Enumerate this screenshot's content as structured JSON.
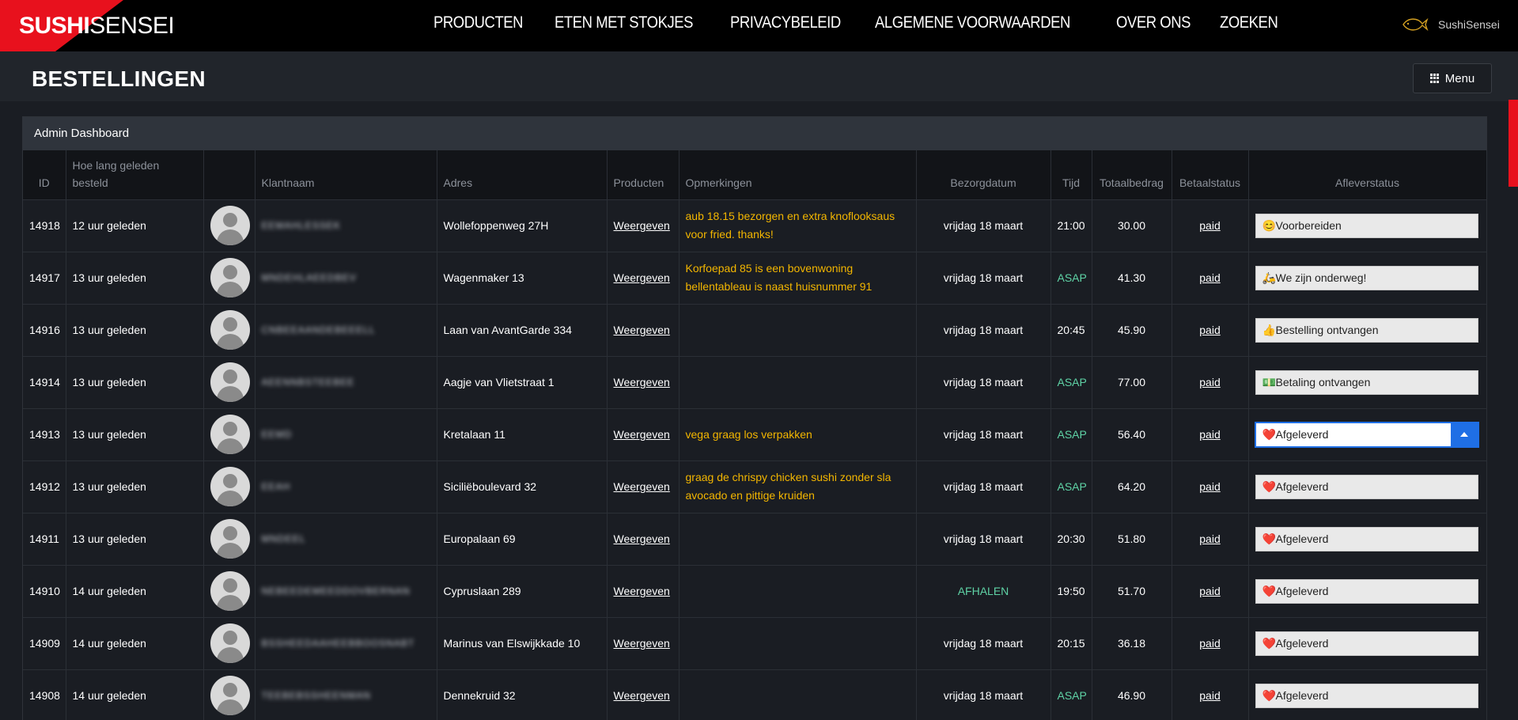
{
  "nav": {
    "logo_bold": "SUSHI",
    "logo_light": "SENSEI",
    "links": [
      "PRODUCTEN",
      "ETEN MET STOKJES",
      "PRIVACYBELEID",
      "ALGEMENE VOORWAARDEN",
      "OVER ONS",
      "ZOEKEN"
    ],
    "brand_name": "SushiSensei"
  },
  "page": {
    "title": "BESTELLINGEN",
    "menu_label": "Menu"
  },
  "panel": {
    "title": "Admin Dashboard"
  },
  "table": {
    "headers": [
      "ID",
      "Hoe lang geleden besteld",
      "",
      "Klantnaam",
      "Adres",
      "Producten",
      "Opmerkingen",
      "Bezorgdatum",
      "Tijd",
      "Totaalbedrag",
      "Betaalstatus",
      "Afleverstatus"
    ],
    "rows": [
      {
        "id": "14918",
        "ago": "12 uur geleden",
        "name": "EEMAHLESSEK",
        "address": "Wollefoppenweg 27H",
        "products": "Weergeven",
        "note": "aub 18.15 bezorgen en extra knoflooksaus voor fried. thanks!",
        "date": "vrijdag 18 maart",
        "time": "21:00",
        "total": "30.00",
        "pay": "paid",
        "status_emoji": "😊",
        "status": "Voorbereiden"
      },
      {
        "id": "14917",
        "ago": "13 uur geleden",
        "name": "MNDEHLAEEDBEV",
        "address": "Wagenmaker 13",
        "products": "Weergeven",
        "note": "Korfoepad 85 is een bovenwoning bellentableau is naast huisnummer 91",
        "date": "vrijdag 18 maart",
        "time": "ASAP",
        "total": "41.30",
        "pay": "paid",
        "status_emoji": "🛵",
        "status": "We zijn onderweg!"
      },
      {
        "id": "14916",
        "ago": "13 uur geleden",
        "name": "CNBEEAANDEBEEELL",
        "address": "Laan van AvantGarde 334",
        "products": "Weergeven",
        "note": "",
        "date": "vrijdag 18 maart",
        "time": "20:45",
        "total": "45.90",
        "pay": "paid",
        "status_emoji": "👍",
        "status": "Bestelling ontvangen"
      },
      {
        "id": "14914",
        "ago": "13 uur geleden",
        "name": "AEENNBSTEEBEE",
        "address": "Aagje van Vlietstraat 1",
        "products": "Weergeven",
        "note": "",
        "date": "vrijdag 18 maart",
        "time": "ASAP",
        "total": "77.00",
        "pay": "paid",
        "status_emoji": "💵",
        "status": "Betaling ontvangen"
      },
      {
        "id": "14913",
        "ago": "13 uur geleden",
        "name": "EEMD",
        "address": "Kretalaan 11",
        "products": "Weergeven",
        "note": "vega graag los verpakken",
        "date": "vrijdag 18 maart",
        "time": "ASAP",
        "total": "56.40",
        "pay": "paid",
        "status_emoji": "❤️",
        "status": "Afgeleverd"
      },
      {
        "id": "14912",
        "ago": "13 uur geleden",
        "name": "EEAH",
        "address": "Siciliëboulevard 32",
        "products": "Weergeven",
        "note": "graag de chrispy chicken sushi zonder sla avocado en pittige kruiden",
        "date": "vrijdag 18 maart",
        "time": "ASAP",
        "total": "64.20",
        "pay": "paid",
        "status_emoji": "❤️",
        "status": "Afgeleverd"
      },
      {
        "id": "14911",
        "ago": "13 uur geleden",
        "name": "MNDEEL",
        "address": "Europalaan 69",
        "products": "Weergeven",
        "note": "",
        "date": "vrijdag 18 maart",
        "time": "20:30",
        "total": "51.80",
        "pay": "paid",
        "status_emoji": "❤️",
        "status": "Afgeleverd"
      },
      {
        "id": "14910",
        "ago": "14 uur geleden",
        "name": "NEBEEDEMEEDDOVBERNAN",
        "address": "Cypruslaan 289",
        "products": "Weergeven",
        "note": "",
        "date": "AFHALEN",
        "time": "19:50",
        "total": "51.70",
        "pay": "paid",
        "status_emoji": "❤️",
        "status": "Afgeleverd"
      },
      {
        "id": "14909",
        "ago": "14 uur geleden",
        "name": "BSSHEEDAAHEEBBOOSNABT",
        "address": "Marinus van Elswijkkade 10",
        "products": "Weergeven",
        "note": "",
        "date": "vrijdag 18 maart",
        "time": "20:15",
        "total": "36.18",
        "pay": "paid",
        "status_emoji": "❤️",
        "status": "Afgeleverd"
      },
      {
        "id": "14908",
        "ago": "14 uur geleden",
        "name": "TEEBEBSSHEENMAN",
        "address": "Dennekruid 32",
        "products": "Weergeven",
        "note": "",
        "date": "vrijdag 18 maart",
        "time": "ASAP",
        "total": "46.90",
        "pay": "paid",
        "status_emoji": "❤️",
        "status": "Afgeleverd"
      }
    ],
    "active_row": 4
  },
  "colors": {
    "accent_red": "#e8111d",
    "note_yellow": "#f3b600",
    "asap_green": "#5fd3a6",
    "select_blue": "#1f6fe5"
  }
}
